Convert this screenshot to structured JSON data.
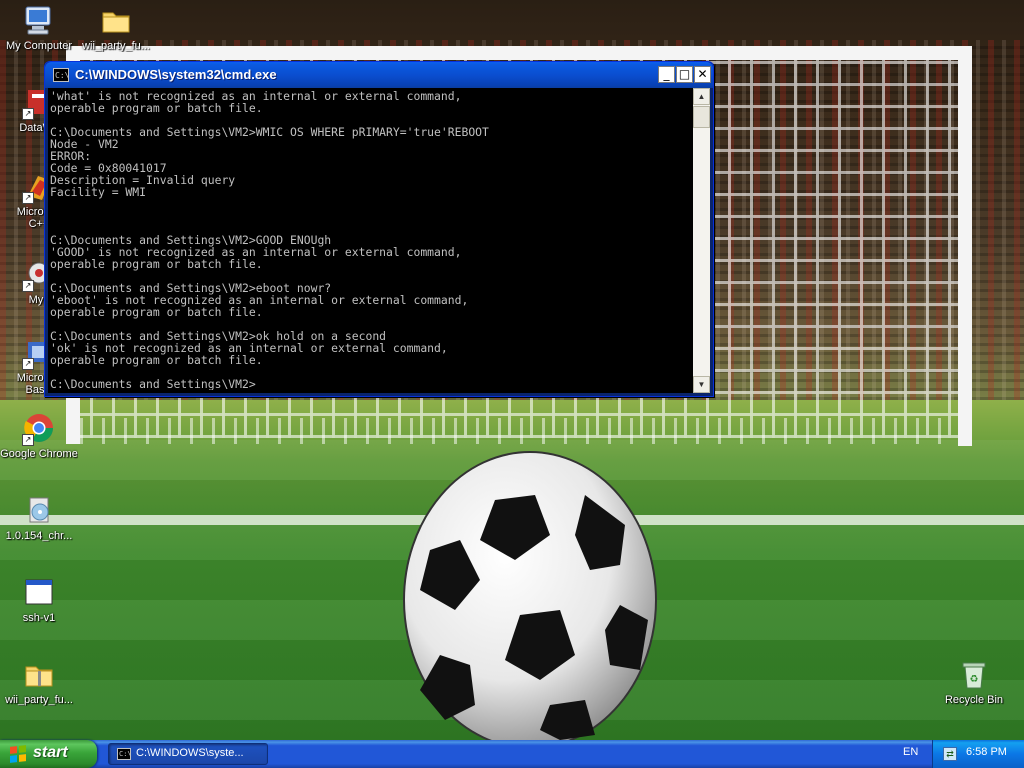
{
  "desktop": {
    "icons": [
      {
        "label": "My Computer",
        "icon": "computer-icon"
      },
      {
        "label": "wii_party_fu...",
        "icon": "folder-icon"
      },
      {
        "label": "DataWa",
        "icon": "app-icon"
      },
      {
        "label": "Microsoft\nC++",
        "icon": "app-icon"
      },
      {
        "label": "Myp",
        "icon": "app-icon"
      },
      {
        "label": "Microsoft\nBasic",
        "icon": "app-icon"
      },
      {
        "label": "Google Chrome",
        "icon": "chrome-icon"
      },
      {
        "label": "1.0.154_chr...",
        "icon": "installer-icon"
      },
      {
        "label": "ssh-v1",
        "icon": "window-icon"
      },
      {
        "label": "wii_party_fu...",
        "icon": "zip-folder-icon"
      },
      {
        "label": "Recycle Bin",
        "icon": "recycle-bin-icon"
      }
    ]
  },
  "cmd": {
    "title": "C:\\WINDOWS\\system32\\cmd.exe",
    "icon_text": "C:\\",
    "buttons": {
      "minimize": "_",
      "maximize": "□",
      "close": "✕"
    },
    "lines": [
      "'what' is not recognized as an internal or external command,",
      "operable program or batch file.",
      "",
      "C:\\Documents and Settings\\VM2>WMIC OS WHERE pRIMARY='true'REBOOT",
      "Node - VM2",
      "ERROR:",
      "Code = 0x80041017",
      "Description = Invalid query",
      "Facility = WMI",
      "",
      "",
      "",
      "C:\\Documents and Settings\\VM2>GOOD ENOUgh",
      "'GOOD' is not recognized as an internal or external command,",
      "operable program or batch file.",
      "",
      "C:\\Documents and Settings\\VM2>eboot nowr?",
      "'eboot' is not recognized as an internal or external command,",
      "operable program or batch file.",
      "",
      "C:\\Documents and Settings\\VM2>ok hold on a second",
      "'ok' is not recognized as an internal or external command,",
      "operable program or batch file.",
      "",
      "C:\\Documents and Settings\\VM2>"
    ]
  },
  "taskbar": {
    "start_label": "start",
    "tasks": [
      {
        "label": "C:\\WINDOWS\\syste...",
        "icon": "cmd-icon"
      }
    ],
    "language": "EN",
    "clock": "6:58 PM"
  },
  "colors": {
    "taskbar_blue": "#2157d7",
    "start_green": "#3aa53a",
    "cmd_text": "#c0c0c0",
    "cmd_bg": "#000000"
  }
}
